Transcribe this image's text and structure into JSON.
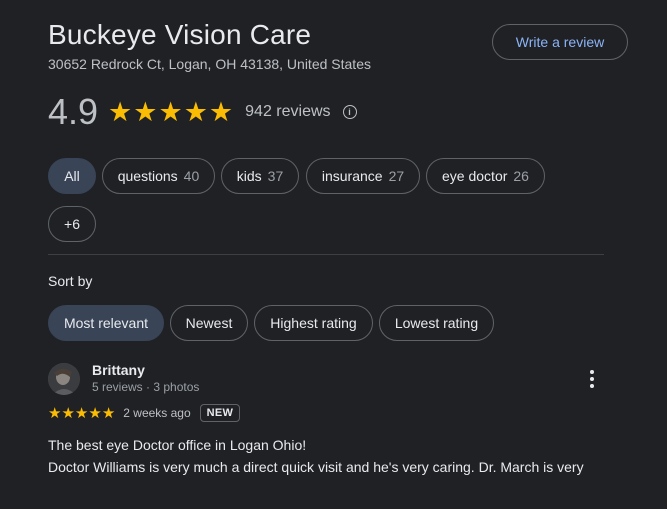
{
  "place": {
    "name": "Buckeye Vision Care",
    "address": "30652 Redrock Ct, Logan, OH 43138, United States",
    "write_review_label": "Write a review",
    "rating": "4.9",
    "stars": 5,
    "review_count": "942 reviews"
  },
  "topic_chips": [
    {
      "label": "All",
      "count": "",
      "active": true
    },
    {
      "label": "questions",
      "count": "40",
      "active": false
    },
    {
      "label": "kids",
      "count": "37",
      "active": false
    },
    {
      "label": "insurance",
      "count": "27",
      "active": false
    },
    {
      "label": "eye doctor",
      "count": "26",
      "active": false
    },
    {
      "label": "+6",
      "count": "",
      "active": false
    }
  ],
  "sort": {
    "label": "Sort by",
    "options": [
      "Most relevant",
      "Newest",
      "Highest rating",
      "Lowest rating"
    ],
    "selected": "Most relevant"
  },
  "review": {
    "author": "Brittany",
    "meta": "5 reviews · 3 photos",
    "stars": 5,
    "time": "2 weeks ago",
    "badge": "NEW",
    "text_line1": "The best eye Doctor office in Logan Ohio!",
    "text_line2": "Doctor Williams is very much a direct quick visit and he's very caring. Dr. March is very"
  },
  "icons": {
    "star": "star-icon",
    "info": "info-icon",
    "more": "more-vert-icon",
    "avatar": "avatar"
  },
  "colors": {
    "background": "#202124",
    "star": "#fbbc04",
    "link": "#8ab4f8",
    "active_chip": "#394457",
    "border": "#5f6368"
  }
}
